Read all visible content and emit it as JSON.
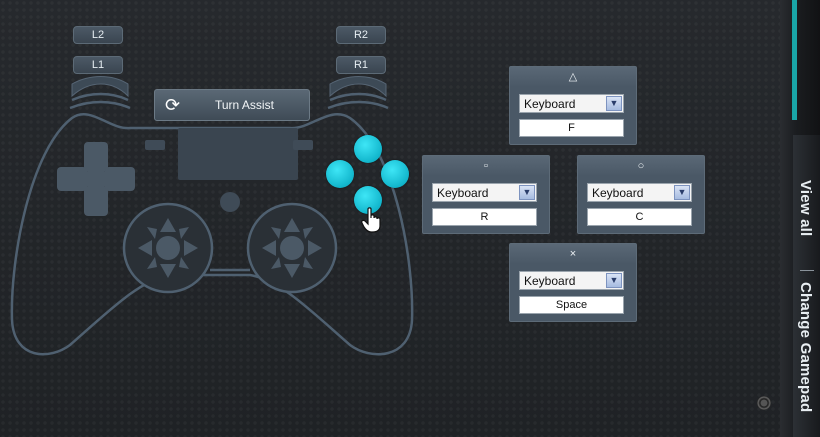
{
  "shoulder_buttons": {
    "l2": "L2",
    "l1": "L1",
    "r2": "R2",
    "r1": "R1"
  },
  "assist_button": {
    "label": "Turn Assist",
    "icon": "refresh-icon"
  },
  "mappings": {
    "triangle": {
      "symbol": "△",
      "device": "Keyboard",
      "key": "F"
    },
    "square": {
      "symbol": "▫",
      "device": "Keyboard",
      "key": "R"
    },
    "circle": {
      "symbol": "○",
      "device": "Keyboard",
      "key": "C"
    },
    "cross": {
      "symbol": "×",
      "device": "Keyboard",
      "key": "Space"
    }
  },
  "side_tabs": {
    "view_all": "View all",
    "change_gamepad": "Change Gamepad"
  },
  "colors": {
    "face_buttons": "#1fc6dc",
    "outline": "#5a6b7a",
    "panel": "#4a5866"
  }
}
